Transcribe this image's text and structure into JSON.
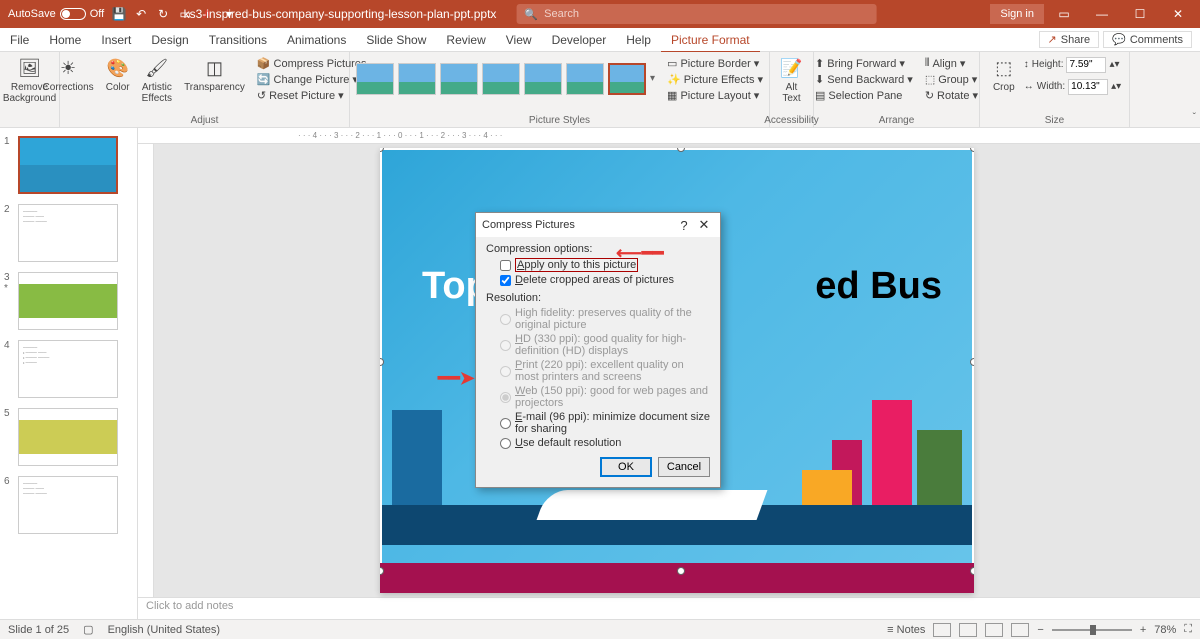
{
  "titlebar": {
    "autosave_label": "AutoSave",
    "autosave_state": "Off",
    "filename": "ks3-inspired-bus-company-supporting-lesson-plan-ppt.pptx",
    "search_placeholder": "Search",
    "signin": "Sign in"
  },
  "menu": {
    "file": "File",
    "home": "Home",
    "insert": "Insert",
    "design": "Design",
    "transitions": "Transitions",
    "animations": "Animations",
    "slideshow": "Slide Show",
    "review": "Review",
    "view": "View",
    "developer": "Developer",
    "help": "Help",
    "picture_format": "Picture Format",
    "share": "Share",
    "comments": "Comments"
  },
  "ribbon": {
    "remove_bg": "Remove\nBackground",
    "corrections": "Corrections",
    "color": "Color",
    "artistic": "Artistic\nEffects",
    "transparency": "Transparency",
    "adjust_label": "Adjust",
    "compress": "Compress Pictures",
    "change": "Change Picture",
    "reset": "Reset Picture",
    "styles_label": "Picture Styles",
    "border": "Picture Border",
    "effects": "Picture Effects",
    "layout": "Picture Layout",
    "alt_text": "Alt\nText",
    "accessibility_label": "Accessibility",
    "bring_forward": "Bring Forward",
    "send_backward": "Send Backward",
    "selection_pane": "Selection Pane",
    "align": "Align",
    "group": "Group",
    "rotate": "Rotate",
    "arrange_label": "Arrange",
    "crop": "Crop",
    "height_label": "Height:",
    "width_label": "Width:",
    "height_val": "7.59\"",
    "width_val": "10.13\"",
    "size_label": "Size"
  },
  "slide": {
    "title_left": "Top",
    "title_right": "ed Bus"
  },
  "dialog": {
    "title": "Compress Pictures",
    "comp_opts": "Compression options:",
    "apply_only": "Apply only to this picture",
    "delete_cropped": "Delete cropped areas of pictures",
    "resolution": "Resolution:",
    "hifi": "High fidelity: preserves quality of the original picture",
    "hd": "HD (330 ppi): good quality for high-definition (HD) displays",
    "print": "Print (220 ppi): excellent quality on most printers and screens",
    "web": "Web (150 ppi): good for web pages and projectors",
    "email": "E-mail (96 ppi): minimize document size for sharing",
    "default": "Use default resolution",
    "ok": "OK",
    "cancel": "Cancel"
  },
  "notes": {
    "placeholder": "Click to add notes"
  },
  "status": {
    "slide": "Slide 1 of 25",
    "lang": "English (United States)",
    "notes": "Notes",
    "zoom": "78%"
  }
}
